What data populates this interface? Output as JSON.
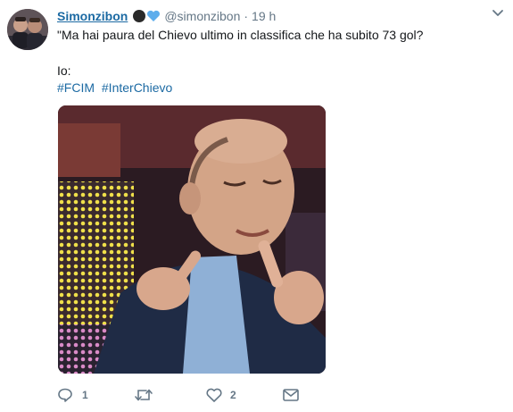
{
  "tweet": {
    "display_name": "Simonzibon",
    "username": "@simonzibon",
    "separator": "·",
    "timestamp": "19 h",
    "text_line1": "\"Ma hai paura del Chievo ultimo in classifica che ha subito 73 gol?",
    "text_line2": "Io:",
    "hashtags": [
      "#FCIM",
      "#InterChievo"
    ],
    "replies": "1",
    "retweets": "",
    "likes": "2"
  },
  "icons": {
    "name_emoji_1": "black-circle-icon",
    "name_emoji_2": "blue-heart-icon",
    "caret": "chevron-down-icon",
    "reply": "reply-icon",
    "retweet": "retweet-icon",
    "like": "heart-icon",
    "dm": "envelope-icon"
  },
  "colors": {
    "link": "#1c6aa3",
    "muted": "#657786",
    "heart_emoji": "#5dadec"
  }
}
